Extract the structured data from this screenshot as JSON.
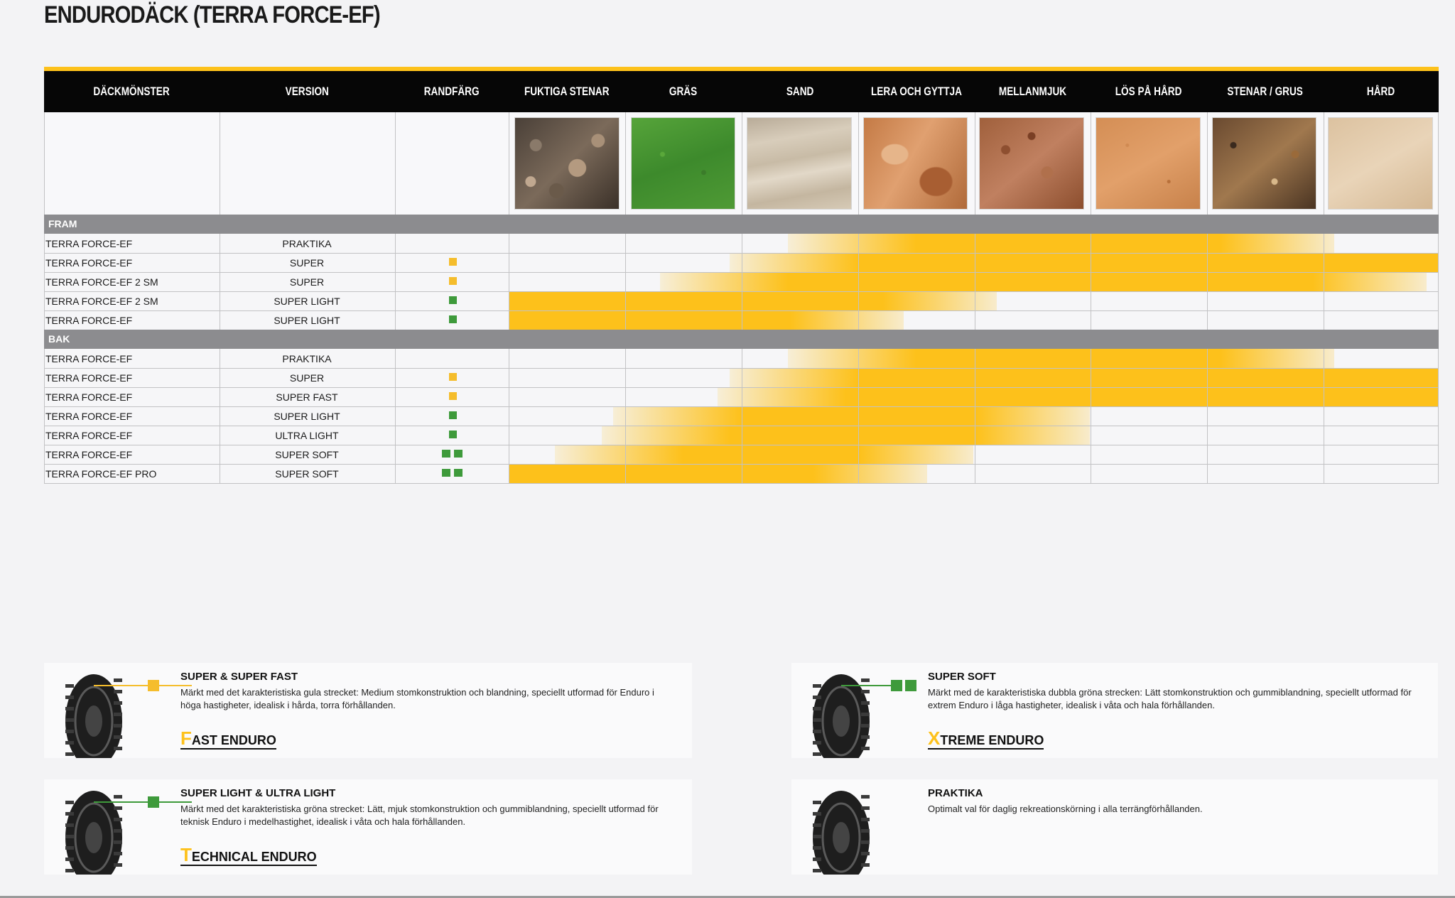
{
  "page": {
    "title": "ENDURODÄCK (TERRA FORCE-EF)"
  },
  "colors": {
    "accent": "#fdc11b",
    "header_bg": "#060606",
    "section_bg": "#8c8c8f",
    "green": "#3e9a3b",
    "yellow": "#f5bd2c"
  },
  "table": {
    "headers": [
      "DÄCKMÖNSTER",
      "VERSION",
      "RANDFÄRG",
      "FUKTIGA STENAR",
      "GRÄS",
      "SAND",
      "LERA OCH GYTTJA",
      "MELLANMJUK",
      "LÖS PÅ HÅRD",
      "STENAR / GRUS",
      "HÅRD"
    ],
    "terrain_images": [
      "wet-rocks",
      "grass",
      "sand",
      "mud-and-clay",
      "medium-soft-soil",
      "loose-on-hard",
      "rocks-gravel",
      "hard-ground"
    ],
    "sections": [
      {
        "label": "FRAM",
        "rows": [
          {
            "name": "TERRA FORCE-EF",
            "version": "PRAKTIKA",
            "rim": "none",
            "range": [
              2.4,
              7.1
            ]
          },
          {
            "name": "TERRA FORCE-EF",
            "version": "SUPER",
            "rim": "yellow",
            "range": [
              1.9,
              8.0
            ]
          },
          {
            "name": "TERRA FORCE-EF 2 SM",
            "version": "SUPER",
            "rim": "yellow",
            "range": [
              1.3,
              7.9
            ]
          },
          {
            "name": "TERRA FORCE-EF 2 SM",
            "version": "SUPER LIGHT",
            "rim": "green",
            "range": [
              0.0,
              4.2
            ]
          },
          {
            "name": "TERRA FORCE-EF",
            "version": "SUPER LIGHT",
            "rim": "green",
            "range": [
              0.0,
              3.4
            ]
          }
        ]
      },
      {
        "label": "BAK",
        "rows": [
          {
            "name": "TERRA FORCE-EF",
            "version": "PRAKTIKA",
            "rim": "none",
            "range": [
              2.4,
              7.1
            ]
          },
          {
            "name": "TERRA FORCE-EF",
            "version": "SUPER",
            "rim": "yellow",
            "range": [
              1.9,
              8.0
            ]
          },
          {
            "name": "TERRA FORCE-EF",
            "version": "SUPER FAST",
            "rim": "yellow",
            "range": [
              1.8,
              8.0
            ]
          },
          {
            "name": "TERRA FORCE-EF",
            "version": "SUPER LIGHT",
            "rim": "green",
            "range": [
              0.9,
              5.0
            ]
          },
          {
            "name": "TERRA FORCE-EF",
            "version": "ULTRA LIGHT",
            "rim": "green",
            "range": [
              0.8,
              5.0
            ]
          },
          {
            "name": "TERRA FORCE-EF",
            "version": "SUPER SOFT",
            "rim": "double-green",
            "range": [
              0.4,
              4.0
            ]
          },
          {
            "name": "TERRA FORCE-EF PRO",
            "version": "SUPER SOFT",
            "rim": "double-green",
            "range": [
              0.0,
              3.6
            ]
          }
        ]
      }
    ]
  },
  "legend": [
    {
      "title": "SUPER & SUPER FAST",
      "desc": "Märkt med det karakteristiska gula strecket: Medium stomkonstruktion och blandning, speciellt utformad för Enduro i höga hastigheter, idealisk i hårda, torra förhållanden.",
      "brand_initial": "F",
      "brand_rest": "AST ENDURO",
      "marker": "yellow",
      "icon": "tyre-icon"
    },
    {
      "title": "SUPER SOFT",
      "desc": "Märkt med de karakteristiska dubbla gröna strecken: Lätt stomkonstruktion och gummiblandning, speciellt utformad för extrem Enduro i låga hastigheter, idealisk i våta och hala förhållanden.",
      "brand_initial": "X",
      "brand_rest": "TREME ENDURO",
      "marker": "double-green",
      "icon": "tyre-icon"
    },
    {
      "title": "SUPER LIGHT & ULTRA LIGHT",
      "desc": "Märkt med det karakteristiska gröna strecket: Lätt, mjuk stomkonstruktion och gummiblandning, speciellt utformad för teknisk Enduro i medelhastighet, idealisk i våta och hala förhållanden.",
      "brand_initial": "T",
      "brand_rest": "ECHNICAL ENDURO",
      "marker": "green",
      "icon": "tyre-icon"
    },
    {
      "title": "PRAKTIKA",
      "desc": "Optimalt val för daglig rekreationskörning i alla terrängförhållanden.",
      "brand_initial": "",
      "brand_rest": "",
      "marker": "none",
      "icon": "tyre-icon"
    }
  ]
}
